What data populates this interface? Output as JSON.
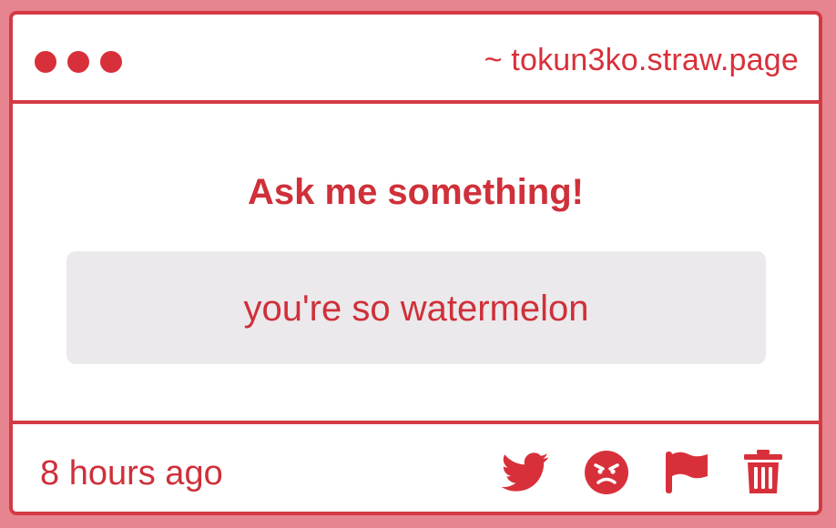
{
  "window": {
    "url": "~ tokun3ko.straw.page",
    "accent_color": "#d43a44",
    "background_color": "#e6858f"
  },
  "question": {
    "title": "Ask me something!",
    "answer": "you're so watermelon"
  },
  "footer": {
    "timestamp": "8 hours ago",
    "actions": [
      {
        "icon": "twitter-icon"
      },
      {
        "icon": "angry-face-icon"
      },
      {
        "icon": "flag-icon"
      },
      {
        "icon": "trash-icon"
      }
    ]
  }
}
